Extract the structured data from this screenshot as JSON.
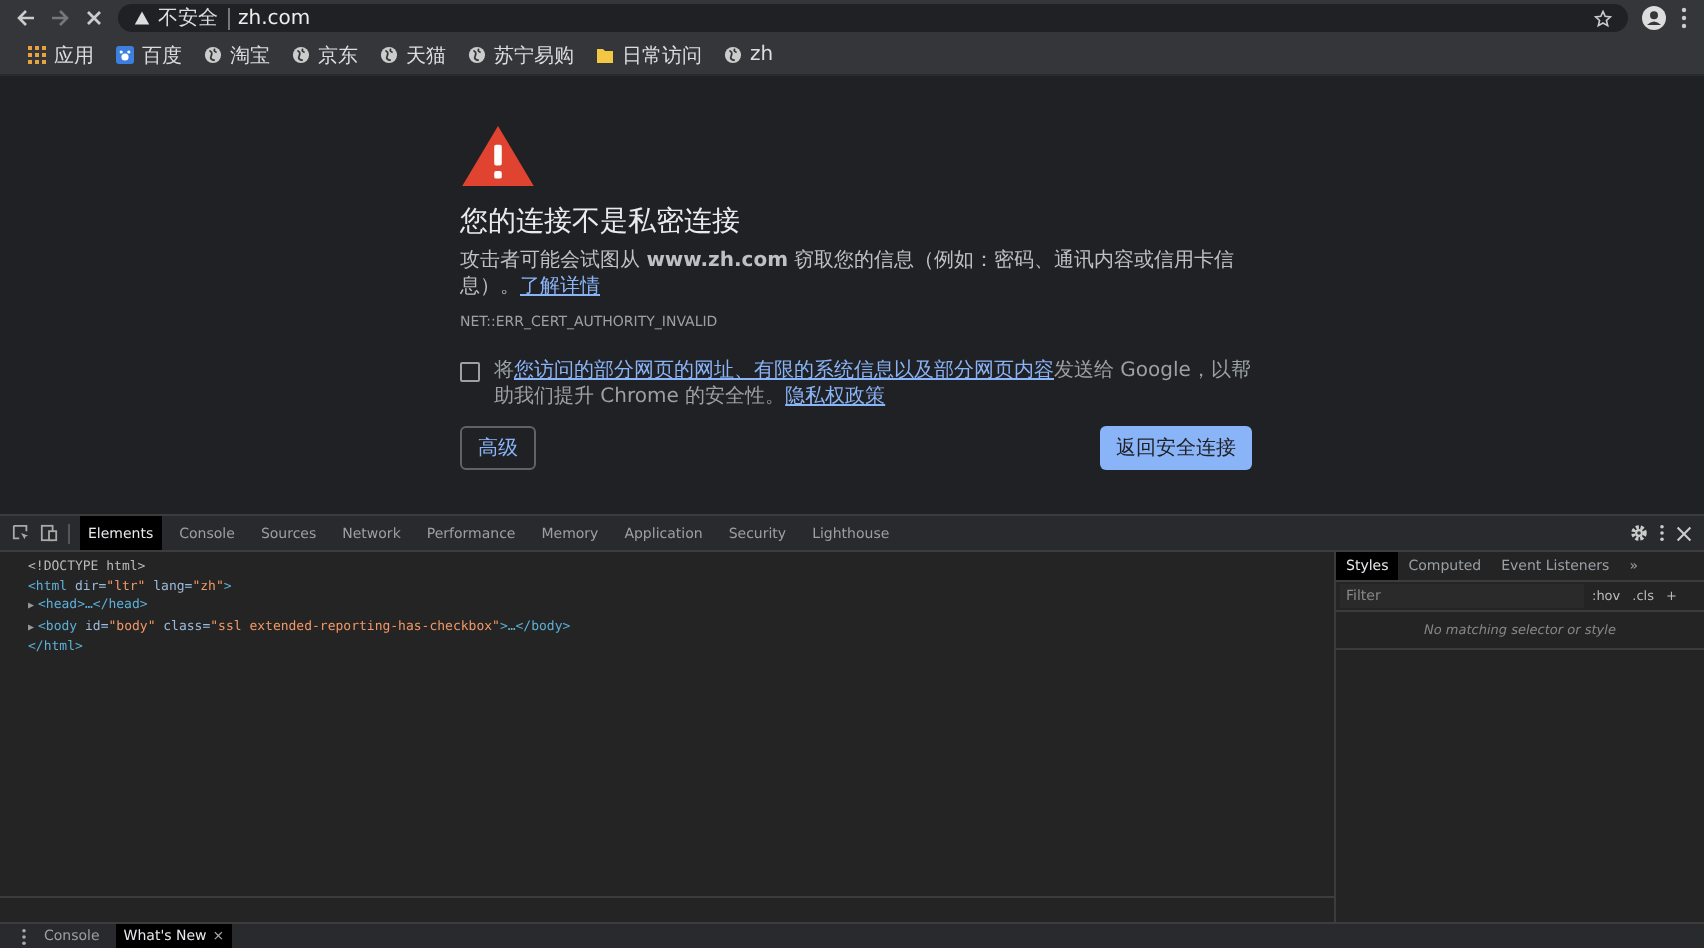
{
  "toolbar": {
    "security_label": "不安全",
    "url": "zh.com"
  },
  "bookmarks": [
    {
      "label": "应用",
      "kind": "apps"
    },
    {
      "label": "百度",
      "kind": "baidu"
    },
    {
      "label": "淘宝",
      "kind": "globe"
    },
    {
      "label": "京东",
      "kind": "globe"
    },
    {
      "label": "天猫",
      "kind": "globe"
    },
    {
      "label": "苏宁易购",
      "kind": "globe"
    },
    {
      "label": "日常访问",
      "kind": "folder"
    },
    {
      "label": "zh",
      "kind": "globe"
    }
  ],
  "interstitial": {
    "heading": "您的连接不是私密连接",
    "description": "攻击者可能会试图从 **www.zh.com** 窃取您的信息（例如：密码、通讯内容或信用卡信息）。",
    "learn_more": "了解详情",
    "error_code": "NET::ERR_CERT_AUTHORITY_INVALID",
    "reporting": {
      "checked": false,
      "parts": [
        {
          "kind": "text",
          "text": "将"
        },
        {
          "kind": "link",
          "text": "您访问的部分网页的网址、有限的系统信息以及部分网页内容"
        },
        {
          "kind": "text",
          "text": "发送给 Google，以帮助我们提升 Chrome 的安全性。"
        },
        {
          "kind": "link",
          "text": "隐私权政策"
        }
      ]
    },
    "advanced_button": "高级",
    "back_button": "返回安全连接"
  },
  "devtools": {
    "tabs": [
      {
        "label": "Elements",
        "selected": true
      },
      {
        "label": "Console",
        "selected": false
      },
      {
        "label": "Sources",
        "selected": false
      },
      {
        "label": "Network",
        "selected": false
      },
      {
        "label": "Performance",
        "selected": false
      },
      {
        "label": "Memory",
        "selected": false
      },
      {
        "label": "Application",
        "selected": false
      },
      {
        "label": "Security",
        "selected": false
      },
      {
        "label": "Lighthouse",
        "selected": false
      }
    ],
    "dom_lines": [
      [
        {
          "kind": "text",
          "text": "<!DOCTYPE html>"
        }
      ],
      [
        {
          "kind": "tag",
          "text": "<html"
        },
        {
          "kind": "attr",
          "text": " dir="
        },
        {
          "kind": "value",
          "text": "\"ltr\""
        },
        {
          "kind": "attr",
          "text": " lang="
        },
        {
          "kind": "value",
          "text": "\"zh\""
        },
        {
          "kind": "tag",
          "text": ">"
        }
      ],
      [
        {
          "kind": "arrow",
          "text": "▶"
        },
        {
          "kind": "tag",
          "text": "<head>…</head>"
        }
      ],
      [
        {
          "kind": "arrow",
          "text": "▶"
        },
        {
          "kind": "tag",
          "text": "<body"
        },
        {
          "kind": "attr",
          "text": " id="
        },
        {
          "kind": "value",
          "text": "\"body\""
        },
        {
          "kind": "attr",
          "text": " class="
        },
        {
          "kind": "value",
          "text": "\"ssl extended-reporting-has-checkbox\""
        },
        {
          "kind": "tag",
          "text": ">…</body>"
        }
      ],
      [
        {
          "kind": "tag",
          "text": "</html>"
        }
      ]
    ],
    "styles_tabs": [
      {
        "label": "Styles",
        "selected": true
      },
      {
        "label": "Computed",
        "selected": false
      },
      {
        "label": "Event Listeners",
        "selected": false
      }
    ],
    "more_tabs": "»",
    "filter_placeholder": "Filter",
    "hov": ":hov",
    "cls": ".cls",
    "add": "+",
    "empty_message": "No matching selector or style",
    "drawer_tabs": [
      {
        "label": "Console",
        "selected": false,
        "closable": false
      },
      {
        "label": "What's New",
        "selected": true,
        "closable": true
      }
    ],
    "close_glyph": "×"
  }
}
